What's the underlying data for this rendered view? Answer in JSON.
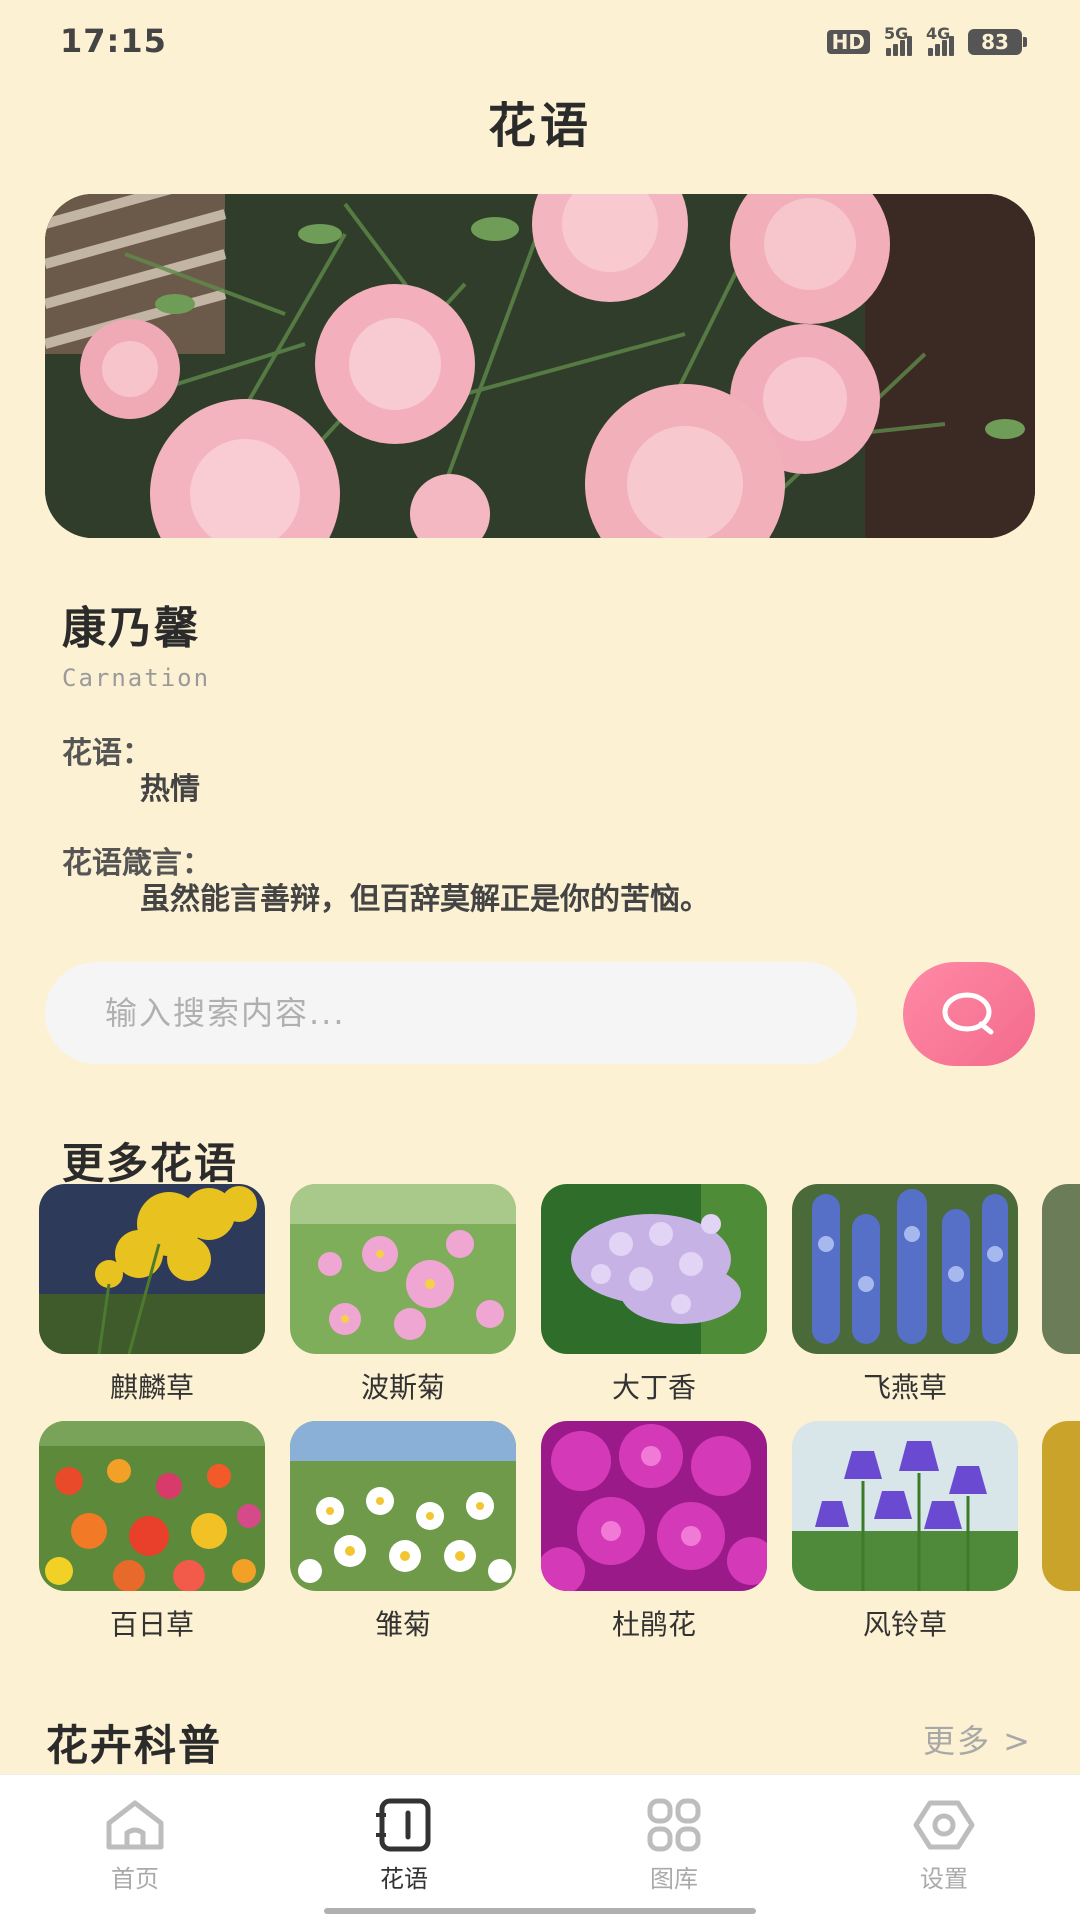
{
  "status_bar": {
    "time": "17:15",
    "hd_badge": "HD",
    "sim1_label": "5G",
    "sim2_label": "4G",
    "battery": "83"
  },
  "header": {
    "title": "花语"
  },
  "featured": {
    "name": "康乃馨",
    "english_name": "Carnation",
    "language_label": "花语：",
    "language_value": "热情",
    "motto_label": "花语箴言：",
    "motto_value": "虽然能言善辩，但百辞莫解正是你的苦恼。"
  },
  "search": {
    "placeholder": "输入搜索内容..."
  },
  "more_section": {
    "title": "更多花语",
    "row1": [
      "麒麟草",
      "波斯菊",
      "大丁香",
      "飞燕草"
    ],
    "row2": [
      "百日草",
      "雏菊",
      "杜鹃花",
      "风铃草"
    ]
  },
  "science_section": {
    "title": "花卉科普",
    "more_label": "更多 >"
  },
  "bottom_nav": {
    "items": [
      {
        "label": "首页",
        "icon": "home-icon"
      },
      {
        "label": "花语",
        "icon": "notebook-icon"
      },
      {
        "label": "图库",
        "icon": "grid-icon"
      },
      {
        "label": "设置",
        "icon": "eye-settings-icon"
      }
    ],
    "active_index": 1
  },
  "colors": {
    "background": "#fdf1d3",
    "accent": "#f36a8c",
    "nav_active": "#333333",
    "nav_inactive": "#aaaaaa"
  }
}
